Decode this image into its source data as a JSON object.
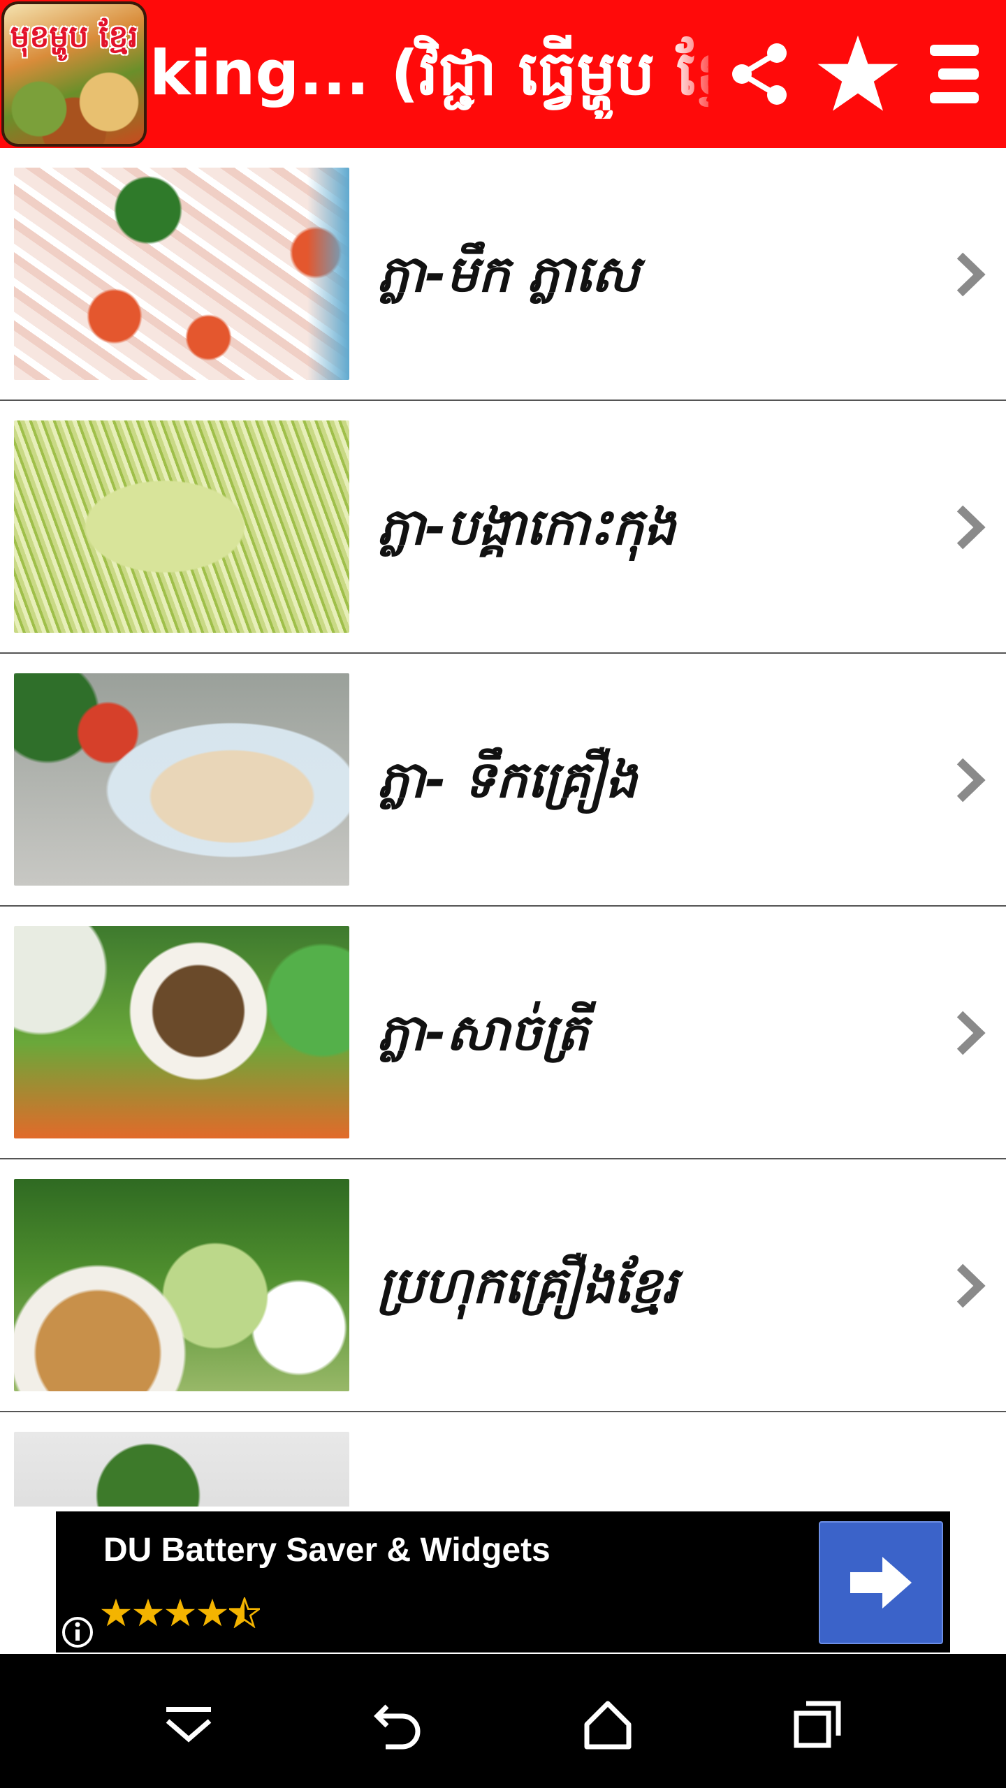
{
  "appbar": {
    "logo_text": "មុខម្ហូប ខ្មែរ",
    "title": "king... (វិជ្ជា ធ្វើម្ហូប ខ្មែរ.",
    "icons": {
      "share": "share-icon",
      "favorite": "star-icon",
      "menu": "menu-icon"
    },
    "color": "#ff0a0a"
  },
  "list": {
    "items": [
      {
        "label": "ភ្លា-មឹក ភ្លាសេ",
        "thumb": "salad-thumbnail"
      },
      {
        "label": "ភ្លា-បង្គាកោះកុង",
        "thumb": "prawn-salad-thumbnail"
      },
      {
        "label": "ភ្លា- ទឹកគ្រឿង",
        "thumb": "dipping-sauce-thumbnail"
      },
      {
        "label": "ភ្លា-សាច់ត្រី",
        "thumb": "fish-dip-thumbnail"
      },
      {
        "label": "ប្រហុកគ្រឿងខ្មែរ",
        "thumb": "prahok-thumbnail"
      },
      {
        "label": "",
        "thumb": "grilled-dish-thumbnail"
      }
    ]
  },
  "ad": {
    "title": "DU Battery Saver & Widgets",
    "rating": 4.5,
    "background": "#000000",
    "cta_color": "#3b63c9"
  },
  "navbar": {
    "buttons": [
      "hide-keyboard-icon",
      "back-icon",
      "home-icon",
      "recents-icon"
    ]
  }
}
